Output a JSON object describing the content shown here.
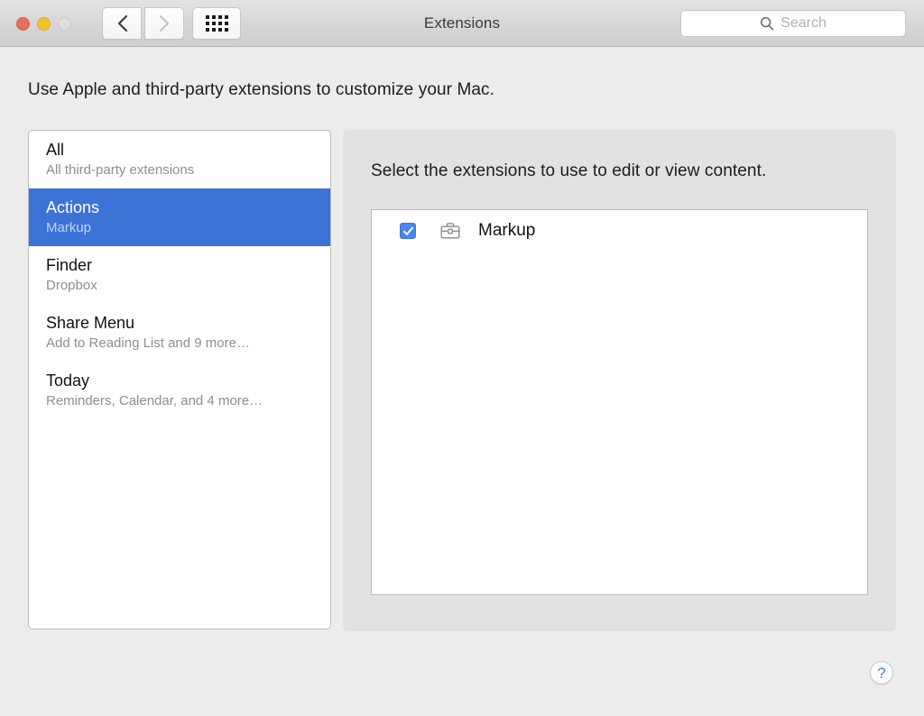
{
  "window": {
    "title": "Extensions",
    "traffic_lights": [
      {
        "name": "close",
        "color": "#e8705f"
      },
      {
        "name": "minimize",
        "color": "#f3c32c"
      },
      {
        "name": "zoom",
        "color": "#dedede"
      }
    ],
    "nav": {
      "back_icon": "chevron-left-icon",
      "forward_icon": "chevron-right-icon",
      "show_all_icon": "grid-icon"
    },
    "search": {
      "placeholder": "Search",
      "value": "",
      "icon": "search-icon"
    }
  },
  "intro": {
    "text": "Use Apple and third-party extensions to customize your Mac."
  },
  "sidebar": {
    "items": [
      {
        "title": "All",
        "subtitle": "All third-party extensions",
        "selected": false
      },
      {
        "title": "Actions",
        "subtitle": "Markup",
        "selected": true
      },
      {
        "title": "Finder",
        "subtitle": "Dropbox",
        "selected": false
      },
      {
        "title": "Share Menu",
        "subtitle": "Add to Reading List and 9 more…",
        "selected": false
      },
      {
        "title": "Today",
        "subtitle": "Reminders, Calendar, and 4 more…",
        "selected": false
      }
    ]
  },
  "panel": {
    "heading": "Select the extensions to use to edit or view content.",
    "extensions": [
      {
        "name": "Markup",
        "checked": true,
        "icon": "toolbox-icon"
      }
    ]
  },
  "help": {
    "label": "?",
    "icon": "question-mark-icon"
  },
  "colors": {
    "selection_blue": "#3d72d6",
    "checkbox_blue": "#4a86ec",
    "help_blue": "#4a7fe8",
    "window_bg": "#ececec",
    "panel_bg": "#e2e2e2"
  }
}
